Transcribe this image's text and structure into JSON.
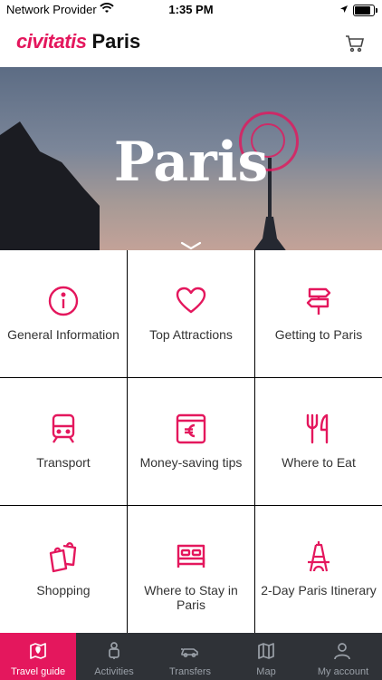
{
  "status_bar": {
    "carrier": "Network Provider",
    "time": "1:35 PM"
  },
  "header": {
    "logo": "civitatis",
    "city": "Paris",
    "cart_icon": "cart-icon"
  },
  "hero": {
    "title": "Paris"
  },
  "tiles": [
    {
      "label": "General Information",
      "icon": "info-icon"
    },
    {
      "label": "Top Attractions",
      "icon": "heart-icon"
    },
    {
      "label": "Getting to Paris",
      "icon": "signpost-icon"
    },
    {
      "label": "Transport",
      "icon": "train-icon"
    },
    {
      "label": "Money-saving tips",
      "icon": "euro-wallet-icon"
    },
    {
      "label": "Where to Eat",
      "icon": "cutlery-icon"
    },
    {
      "label": "Shopping",
      "icon": "shopping-bags-icon"
    },
    {
      "label": "Where to Stay in Paris",
      "icon": "bed-icon"
    },
    {
      "label": "2-Day Paris Itinerary",
      "icon": "eiffel-tower-icon"
    }
  ],
  "tabs": [
    {
      "label": "Travel guide",
      "icon": "map-marker-icon"
    },
    {
      "label": "Activities",
      "icon": "traveler-icon"
    },
    {
      "label": "Transfers",
      "icon": "car-icon"
    },
    {
      "label": "Map",
      "icon": "map-icon"
    },
    {
      "label": "My account",
      "icon": "user-icon"
    }
  ],
  "colors": {
    "accent": "#e4175d",
    "tabbar": "#2f3237",
    "tile_bg": "#ffffff",
    "grid_line": "#000000"
  }
}
